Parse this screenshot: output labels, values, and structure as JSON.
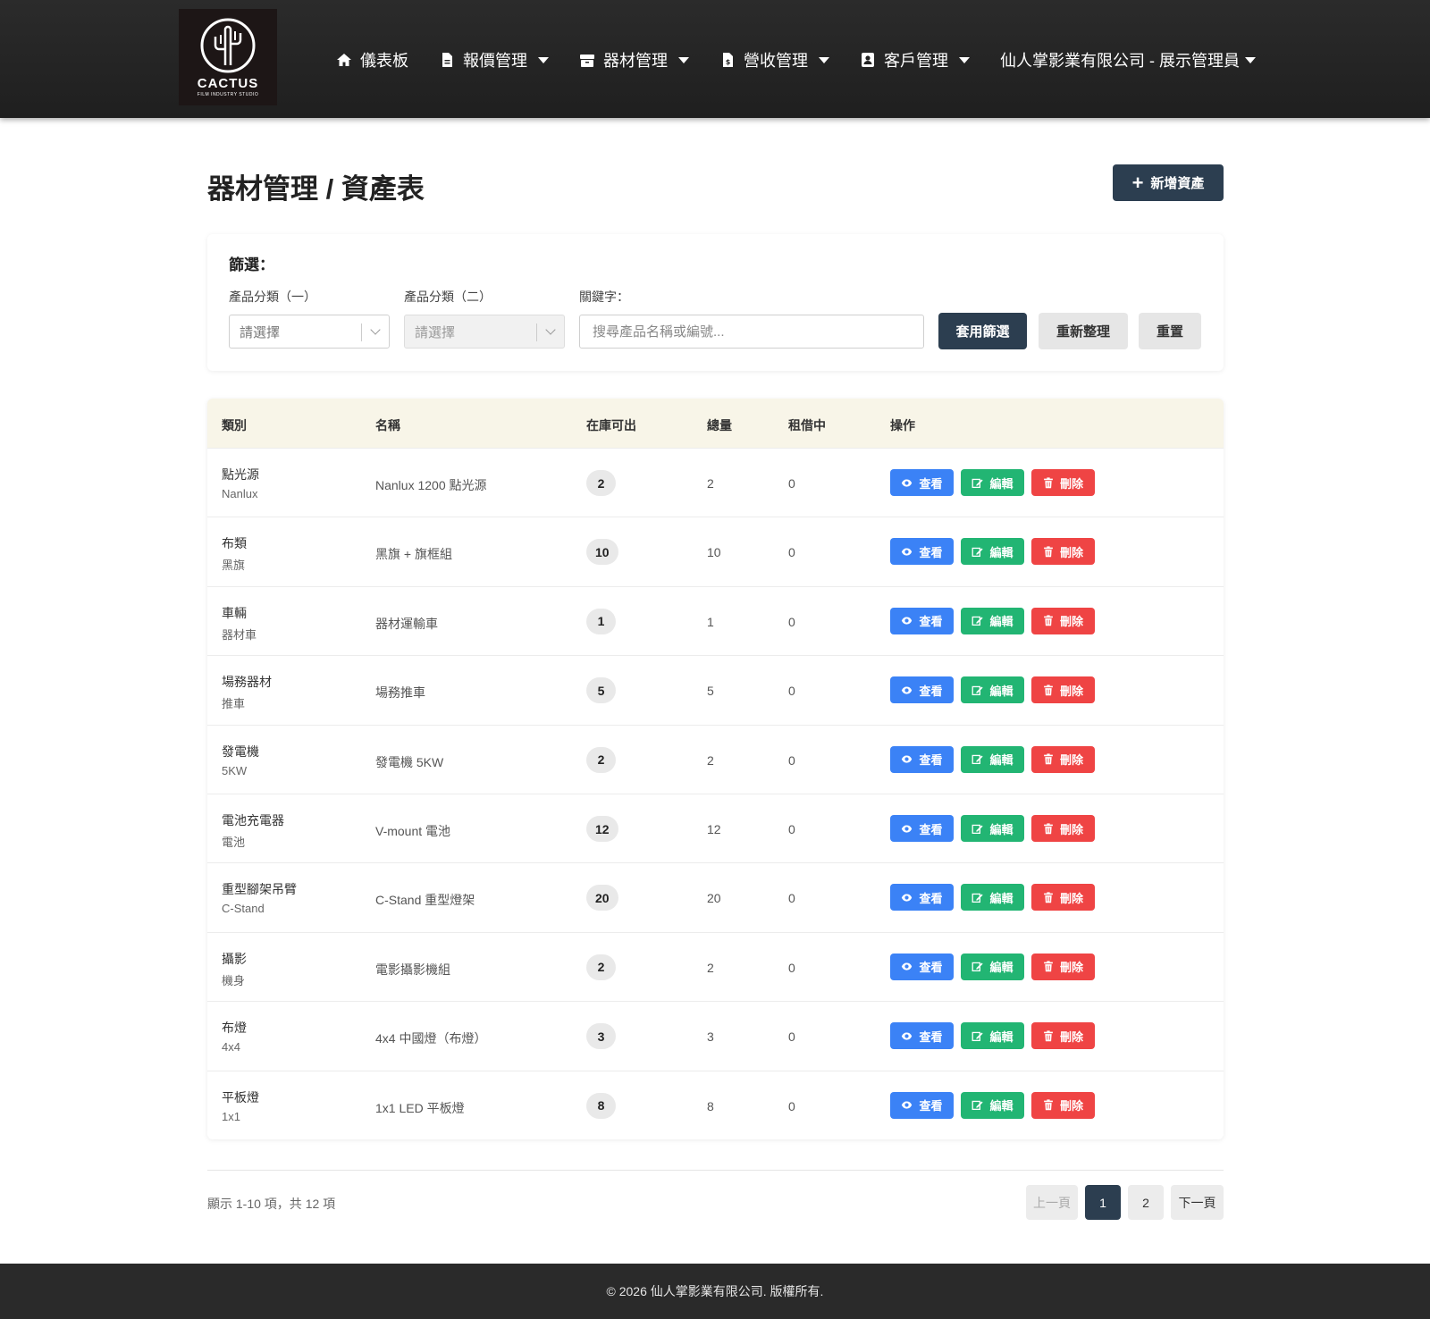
{
  "brand": {
    "name": "CACTUS",
    "tagline": "FILM INDUSTRY STUDIO"
  },
  "nav": {
    "items": [
      {
        "label": "儀表板",
        "icon": "home-icon",
        "dropdown": false
      },
      {
        "label": "報價管理",
        "icon": "file-icon",
        "dropdown": true
      },
      {
        "label": "器材管理",
        "icon": "box-icon",
        "dropdown": true
      },
      {
        "label": "營收管理",
        "icon": "invoice-icon",
        "dropdown": true
      },
      {
        "label": "客戶管理",
        "icon": "contact-icon",
        "dropdown": true
      }
    ],
    "user": "仙人掌影業有限公司 - 展示管理員"
  },
  "page": {
    "title": "器材管理 / 資產表",
    "add_button": "新增資產"
  },
  "filter": {
    "title": "篩選：",
    "category1": {
      "label": "產品分類（一）",
      "value": "請選擇"
    },
    "category2": {
      "label": "產品分類（二）",
      "value": "請選擇"
    },
    "keyword": {
      "label": "關鍵字：",
      "placeholder": "搜尋產品名稱或編號..."
    },
    "apply": "套用篩選",
    "refresh": "重新整理",
    "reset": "重置"
  },
  "table": {
    "headers": [
      "類別",
      "名稱",
      "在庫可出",
      "總量",
      "租借中",
      "操作"
    ],
    "actions": {
      "view": "查看",
      "edit": "編輯",
      "delete": "刪除"
    },
    "rows": [
      {
        "category": "點光源",
        "sub": "Nanlux",
        "name": "Nanlux 1200 點光源",
        "available": "2",
        "total": "2",
        "rented": "0"
      },
      {
        "category": "布類",
        "sub": "黑旗",
        "name": "黑旗 + 旗框組",
        "available": "10",
        "total": "10",
        "rented": "0"
      },
      {
        "category": "車輛",
        "sub": "器材車",
        "name": "器材運輸車",
        "available": "1",
        "total": "1",
        "rented": "0"
      },
      {
        "category": "場務器材",
        "sub": "推車",
        "name": "場務推車",
        "available": "5",
        "total": "5",
        "rented": "0"
      },
      {
        "category": "發電機",
        "sub": "5KW",
        "name": "發電機 5KW",
        "available": "2",
        "total": "2",
        "rented": "0"
      },
      {
        "category": "電池充電器",
        "sub": "電池",
        "name": "V-mount 電池",
        "available": "12",
        "total": "12",
        "rented": "0"
      },
      {
        "category": "重型腳架吊臂",
        "sub": "C-Stand",
        "name": "C-Stand 重型燈架",
        "available": "20",
        "total": "20",
        "rented": "0"
      },
      {
        "category": "攝影",
        "sub": "機身",
        "name": "電影攝影機組",
        "available": "2",
        "total": "2",
        "rented": "0"
      },
      {
        "category": "布燈",
        "sub": "4x4",
        "name": "4x4 中國燈（布燈）",
        "available": "3",
        "total": "3",
        "rented": "0"
      },
      {
        "category": "平板燈",
        "sub": "1x1",
        "name": "1x1 LED 平板燈",
        "available": "8",
        "total": "8",
        "rented": "0"
      }
    ]
  },
  "pagination": {
    "summary": "顯示 1-10 項，共 12 項",
    "prev": "上一頁",
    "pages": [
      "1",
      "2"
    ],
    "current": "1",
    "next": "下一頁"
  },
  "footer": "© 2026 仙人掌影業有限公司. 版權所有.",
  "colors": {
    "navbar": "#242424",
    "primary": "#2c3e50",
    "view": "#3b82f6",
    "edit": "#22b573",
    "delete": "#ef4444",
    "table_header": "#f8f5e8"
  }
}
